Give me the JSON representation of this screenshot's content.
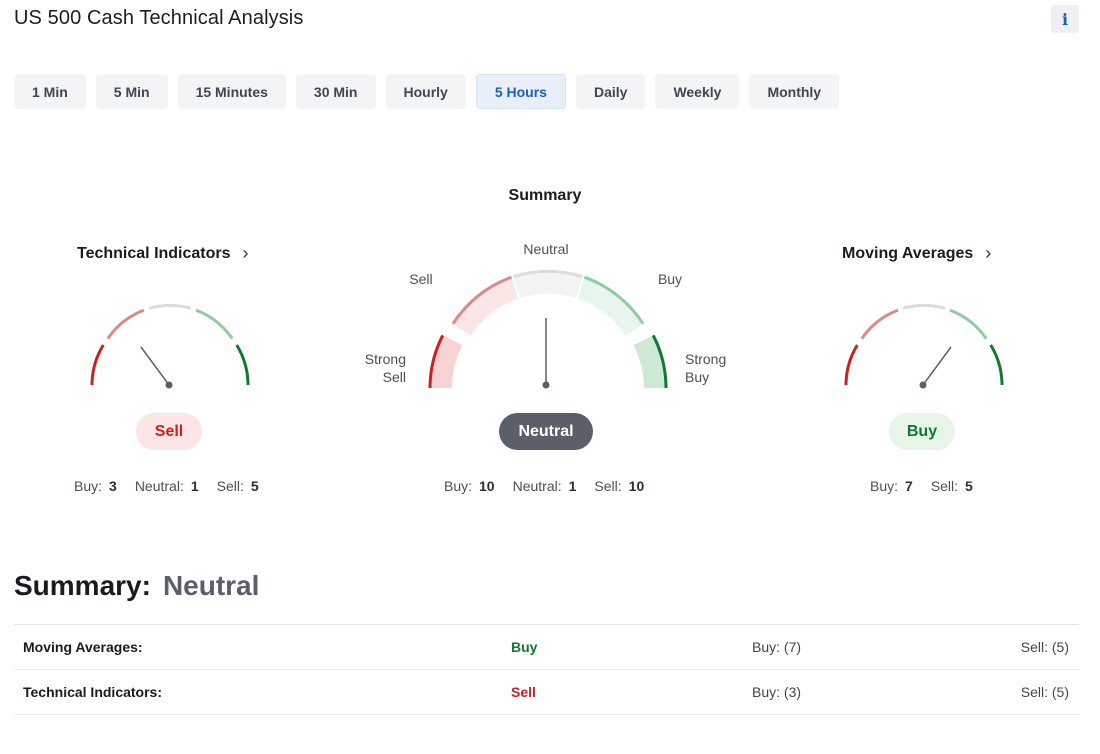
{
  "title": "US 500 Cash Technical Analysis",
  "info_label": "i",
  "tabs": [
    {
      "label": "1 Min"
    },
    {
      "label": "5 Min"
    },
    {
      "label": "15 Minutes"
    },
    {
      "label": "30 Min"
    },
    {
      "label": "Hourly"
    },
    {
      "label": "5 Hours",
      "active": true
    },
    {
      "label": "Daily"
    },
    {
      "label": "Weekly"
    },
    {
      "label": "Monthly"
    }
  ],
  "technical_indicators": {
    "heading": "Technical Indicators",
    "chevron": "›",
    "verdict": "Sell",
    "buy_label": "Buy:",
    "buy": "3",
    "neutral_label": "Neutral:",
    "neutral": "1",
    "sell_label": "Sell:",
    "sell": "5"
  },
  "summary_gauge": {
    "heading": "Summary",
    "labels": {
      "strong_sell_1": "Strong",
      "strong_sell_2": "Sell",
      "sell": "Sell",
      "neutral": "Neutral",
      "buy": "Buy",
      "strong_buy_1": "Strong",
      "strong_buy_2": "Buy"
    },
    "verdict": "Neutral",
    "buy_label": "Buy:",
    "buy": "10",
    "neutral_label": "Neutral:",
    "neutral": "1",
    "sell_label": "Sell:",
    "sell": "10"
  },
  "moving_averages": {
    "heading": "Moving Averages",
    "chevron": "›",
    "verdict": "Buy",
    "buy_label": "Buy:",
    "buy": "7",
    "sell_label": "Sell:",
    "sell": "5"
  },
  "summary": {
    "label": "Summary:",
    "value": "Neutral"
  },
  "table": {
    "rows": [
      {
        "name": "Moving Averages:",
        "action": "Buy",
        "buy": "Buy: (7)",
        "sell": "Sell: (5)"
      },
      {
        "name": "Technical Indicators:",
        "action": "Sell",
        "buy": "Buy: (3)",
        "sell": "Sell: (5)"
      }
    ]
  },
  "colors": {
    "strong_sell": "#cc1f1f",
    "sell": "#d98b88",
    "neutral": "#dcdcdc",
    "buy": "#8fcca0",
    "strong_buy": "#0f7a2f",
    "active_tab": "#1f5fb5"
  }
}
